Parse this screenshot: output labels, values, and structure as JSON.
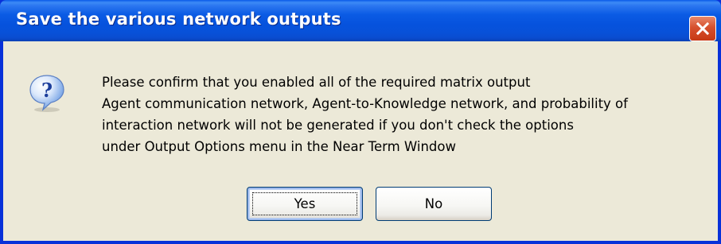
{
  "window": {
    "title": "Save the various network outputs"
  },
  "icons": {
    "dialog_icon": "question-icon",
    "close": "close-icon"
  },
  "message": {
    "lines": [
      "Please confirm that you enabled all of the required matrix output",
      "Agent communication network, Agent-to-Knowledge network, and probability of",
      "interaction network will not be generated if you don't check the options",
      "under Output Options menu in the Near Term Window"
    ]
  },
  "buttons": {
    "yes_label": "Yes",
    "no_label": "No"
  },
  "colors": {
    "titlebar_blue": "#0a5ae8",
    "frame_blue": "#0831d9",
    "dialog_face": "#ece9d8",
    "close_red": "#d6502d"
  }
}
